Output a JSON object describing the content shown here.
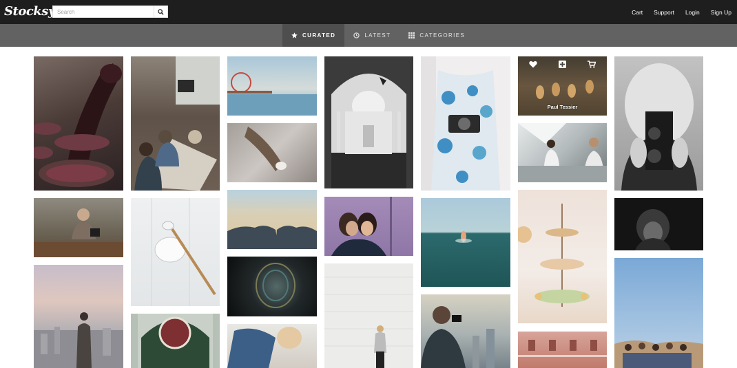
{
  "header": {
    "logo": "Stocksy",
    "search_placeholder": "Search",
    "links": [
      "Cart",
      "Support",
      "Login",
      "Sign Up"
    ]
  },
  "tabs": [
    {
      "label": "Curated",
      "icon": "star-icon",
      "active": true
    },
    {
      "label": "Latest",
      "icon": "clock-icon",
      "active": false
    },
    {
      "label": "Categories",
      "icon": "grid-icon",
      "active": false
    }
  ],
  "hover_overlay": {
    "photographer": "Paul Tessier",
    "icons": [
      "heart-icon",
      "plus-icon",
      "cart-icon"
    ]
  },
  "colors": {
    "topbar": "#1e1e1e",
    "subnav": "#626262",
    "subnav_active": "#4e4e4e"
  }
}
